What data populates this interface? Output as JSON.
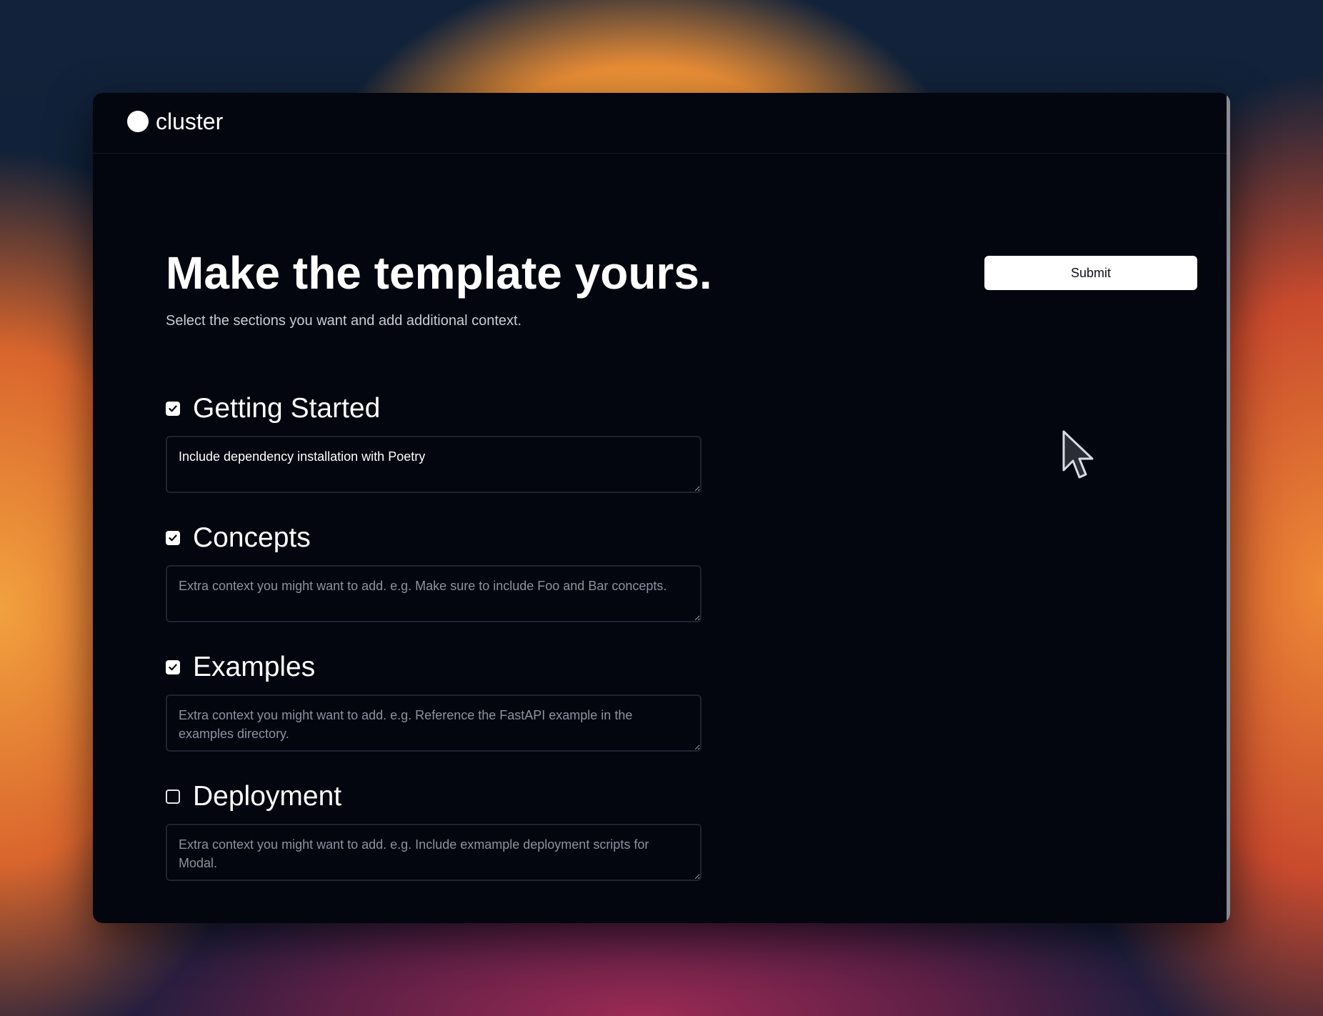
{
  "app": {
    "name": "cluster"
  },
  "header": {
    "title": "Make the template yours.",
    "subtitle": "Select the sections you want and add additional context."
  },
  "actions": {
    "submit_label": "Submit"
  },
  "sections": [
    {
      "title": "Getting Started",
      "checked": true,
      "value": "Include dependency installation with Poetry",
      "placeholder": ""
    },
    {
      "title": "Concepts",
      "checked": true,
      "value": "",
      "placeholder": "Extra context you might want to add. e.g. Make sure to include Foo and Bar concepts."
    },
    {
      "title": "Examples",
      "checked": true,
      "value": "",
      "placeholder": "Extra context you might want to add. e.g. Reference the FastAPI example in the examples directory."
    },
    {
      "title": "Deployment",
      "checked": false,
      "value": "",
      "placeholder": "Extra context you might want to add. e.g. Include exmample deployment scripts for Modal."
    }
  ],
  "colors": {
    "window_background": "#03050f",
    "accent": "#ffffff",
    "border": "#1f2433",
    "placeholder_text": "#8d929f"
  },
  "icons": {
    "logo": "circle-icon",
    "checked": "checkmark-icon",
    "pointer": "mouse-pointer-icon"
  }
}
